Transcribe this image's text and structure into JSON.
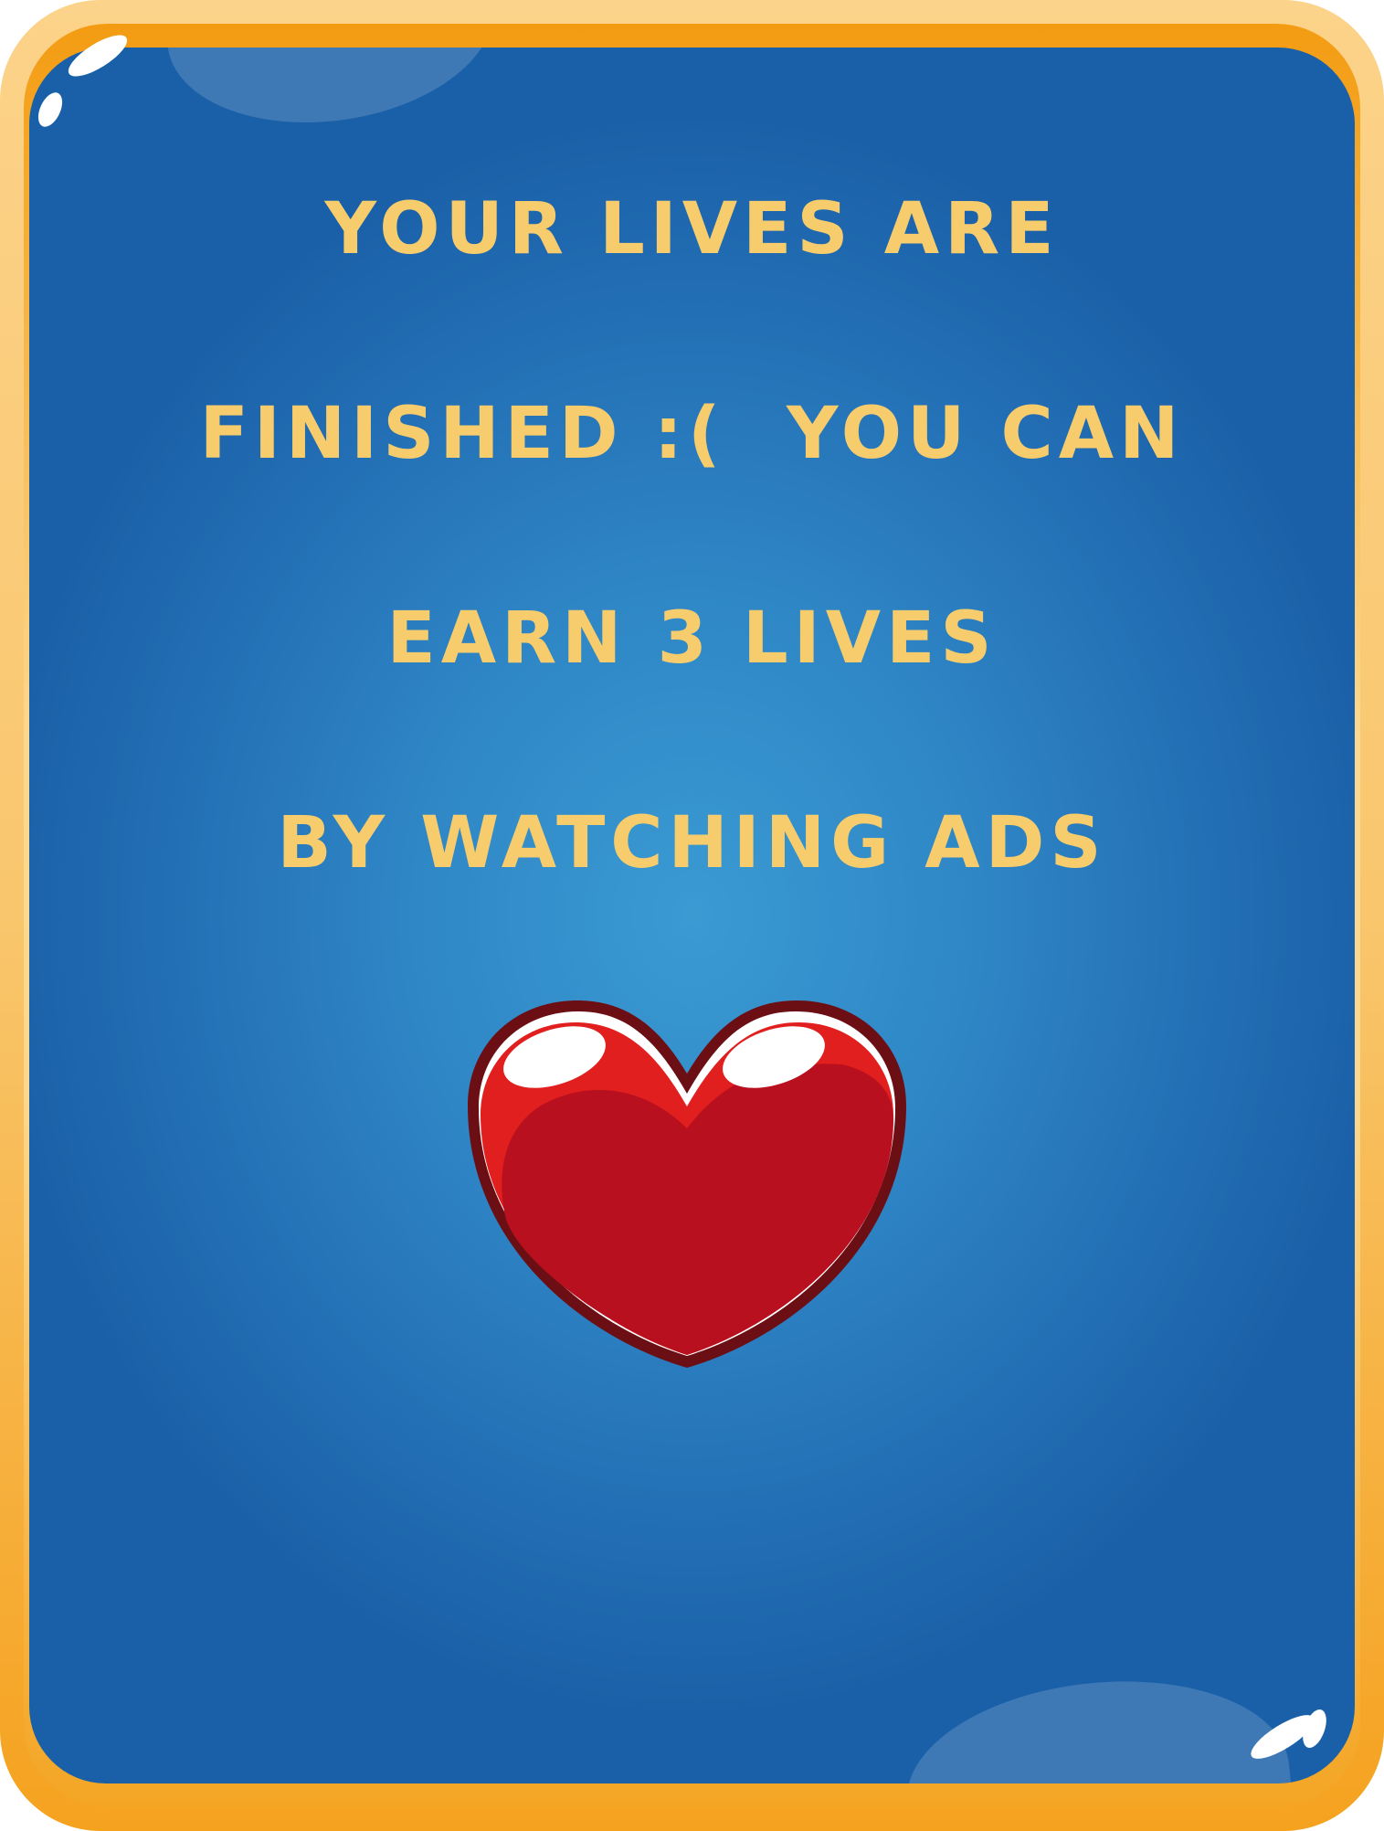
{
  "dialog": {
    "message_lines": [
      "YOUR LIVES ARE",
      "FINISHED :(  YOU CAN",
      "EARN 3 LIVES",
      "BY WATCHING ADS"
    ],
    "icon": "heart-icon"
  },
  "colors": {
    "text": "#f7cc6c",
    "panel": "#2f87c6",
    "frame": "#f9c66d",
    "heart": "#e21f1f",
    "heart_shadow": "#b8101e",
    "heart_outline": "#6b0f14"
  }
}
